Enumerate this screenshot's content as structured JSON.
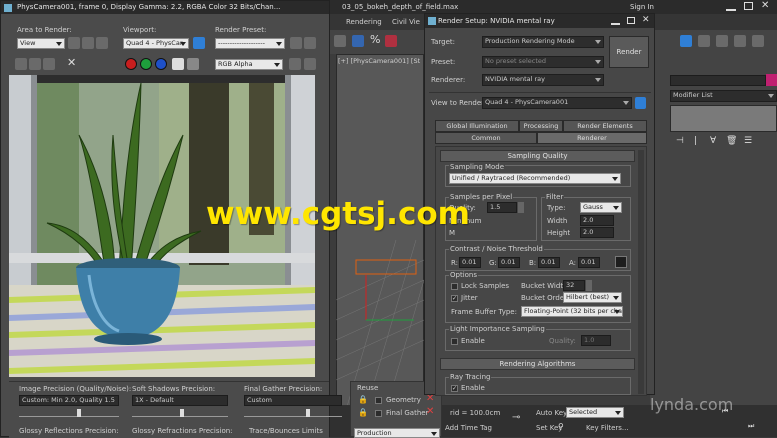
{
  "vfb": {
    "title": "PhysCamera001, frame 0, Display Gamma: 2.2, RGBA Color 32 Bits/Chan...",
    "area_label": "Area to Render:",
    "area_value": "View",
    "viewport_label": "Viewport:",
    "viewport_value": "Quad 4 - PhysCar",
    "preset_label": "Render Preset:",
    "preset_value": "--------------------",
    "channel_value": "RGB Alpha",
    "panel": {
      "image_precision_label": "Image Precision (Quality/Noise):",
      "image_precision_value": "Custom: Min 2.0, Quality 1.5",
      "soft_shadows_label": "Soft Shadows Precision:",
      "soft_shadows_value": "1X - Default",
      "final_gather_label": "Final Gather Precision:",
      "final_gather_value": "Custom",
      "reuse_label": "Reuse",
      "geometry_label": "Geometry",
      "final_gather_check_label": "Final Gather",
      "glossy_reflections_label": "Glossy Reflections Precision:",
      "glossy_refractions_label": "Glossy Refractions Precision:",
      "trace_bounces_label": "Trace/Bounces Limits",
      "production_value": "Production"
    }
  },
  "max": {
    "file_title": "03_05_bokeh_depth_of_field.max",
    "menu_rendering": "Rendering",
    "menu_civil": "Civil Vie",
    "sign_in": "Sign In",
    "viewport_label": "[+] [PhysCamera001] [St",
    "grid_label": "rid = 100.0cm",
    "add_time_tag": "Add Time Tag",
    "auto_key": "Auto Key",
    "set_key": "Set Key",
    "selected_value": "Selected",
    "key_filters": "Key Filters...",
    "modifier_list": "Modifier List"
  },
  "render_setup": {
    "title": "Render Setup: NVIDIA mental ray",
    "target_label": "Target:",
    "target_value": "Production Rendering Mode",
    "preset_label": "Preset:",
    "preset_value": "No preset selected",
    "renderer_label": "Renderer:",
    "renderer_value": "NVIDIA mental ray",
    "view_label": "View to Render:",
    "view_value": "Quad 4 - PhysCamera001",
    "render_button": "Render",
    "tabs_row1": [
      "Global Illumination",
      "Processing",
      "Render Elements"
    ],
    "tabs_row2": [
      "Common",
      "Renderer"
    ],
    "sampling_quality_header": "Sampling Quality",
    "sampling_mode_label": "Sampling Mode",
    "sampling_mode_value": "Unified / Raytraced (Recommended)",
    "samples_per_pixel_label": "Samples per Pixel",
    "quality_label": "Quality:",
    "quality_value": "1.5",
    "minimum_label": "Minimum",
    "maximum_label": "M",
    "filter_label": "Filter",
    "type_label": "Type:",
    "type_value": "Gauss",
    "width_label": "Width",
    "width_value": "2.0",
    "height_label": "Height",
    "height_value": "2.0",
    "contrast_label": "Contrast / Noise Threshold",
    "contrast_channels": [
      {
        "label": "R:",
        "value": "0.01"
      },
      {
        "label": "G:",
        "value": "0.01"
      },
      {
        "label": "B:",
        "value": "0.01"
      },
      {
        "label": "A:",
        "value": "0.01"
      }
    ],
    "options_label": "Options",
    "lock_samples_label": "Lock Samples",
    "jitter_label": "Jitter",
    "bucket_width_label": "Bucket Width:",
    "bucket_width_value": "32",
    "bucket_order_label": "Bucket Order:",
    "bucket_order_value": "Hilbert (best)",
    "frame_buffer_label": "Frame Buffer Type:",
    "frame_buffer_value": "Floating-Point (32 bits per cha",
    "light_importance_label": "Light Importance Sampling",
    "enable_label": "Enable",
    "quality2_label": "Quality:",
    "quality2_value": "1.0",
    "rendering_algorithms_header": "Rendering Algorithms",
    "ray_tracing_label": "Ray Tracing",
    "ray_enable_label": "Enable"
  },
  "watermark": "www.cgtsj.com",
  "watermark2": "lynda.com",
  "colors": {
    "watermark": "#ffe600",
    "swatch_red": "#c81e1e",
    "swatch_green": "#1ea03c",
    "swatch_blue": "#1e50c8",
    "accent_blue": "#2f7fd6"
  }
}
